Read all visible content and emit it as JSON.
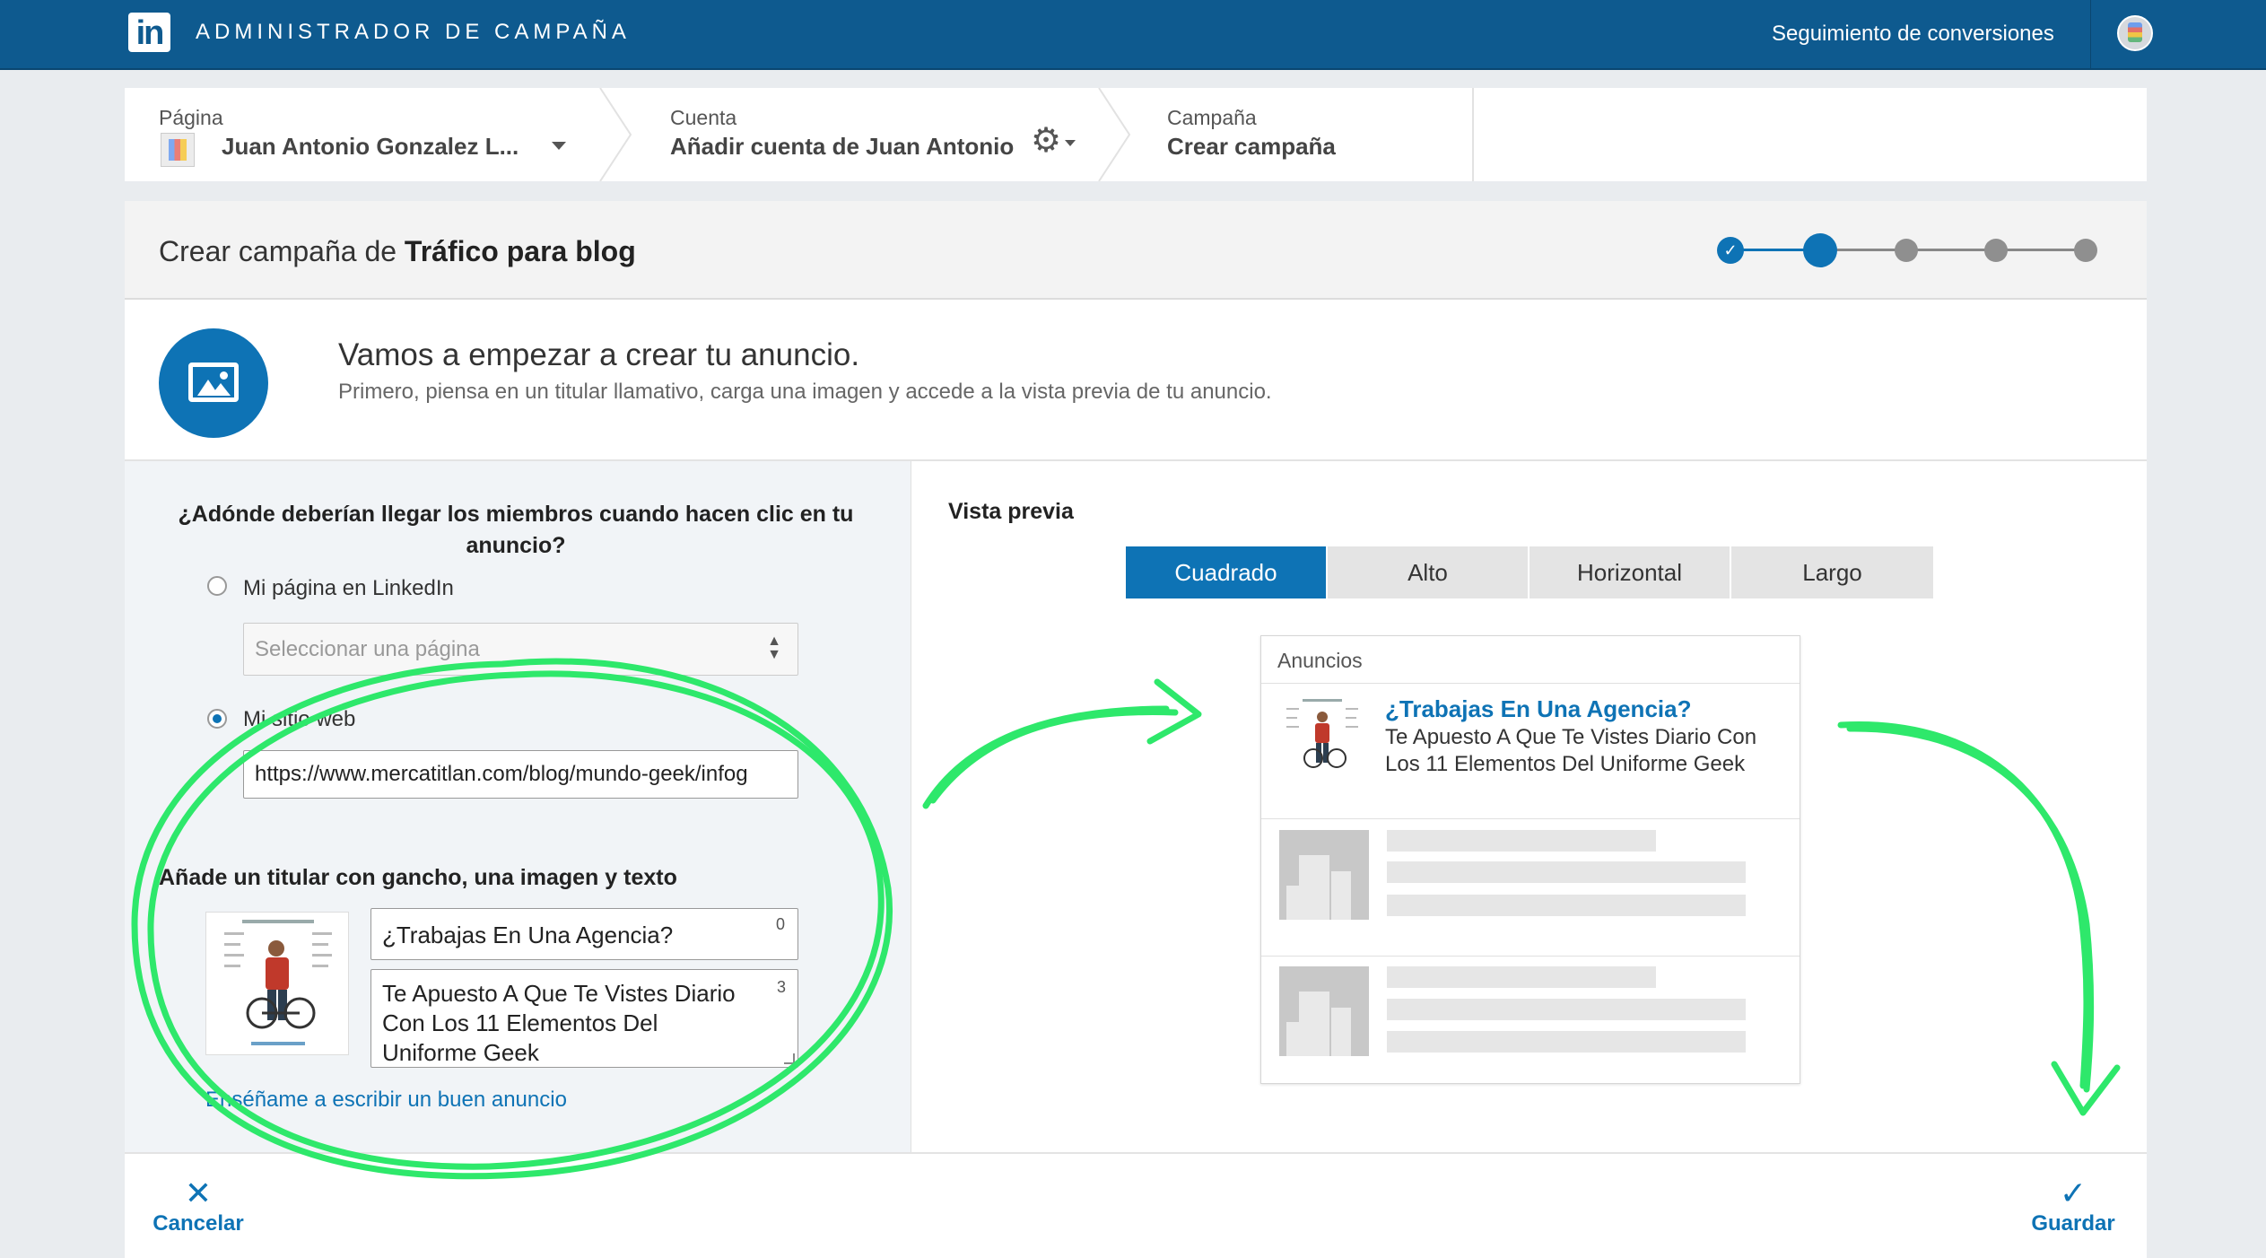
{
  "topbar": {
    "logo": "in",
    "app_title": "ADMINISTRADOR DE CAMPAÑA",
    "conversion_link": "Seguimiento de conversiones"
  },
  "breadcrumb": {
    "page": {
      "label": "Página",
      "value": "Juan Antonio Gonzalez L..."
    },
    "account": {
      "label": "Cuenta",
      "value": "Añadir cuenta de Juan Antonio"
    },
    "campaign": {
      "label": "Campaña",
      "value": "Crear campaña"
    }
  },
  "header": {
    "title_prefix": "Crear campaña de ",
    "title_bold": "Tráfico para blog",
    "steps_total": 5,
    "current_step": 2
  },
  "intro": {
    "heading": "Vamos a empezar a crear tu anuncio.",
    "subheading": "Primero, piensa en un titular llamativo, carga una imagen y accede a la vista previa de tu anuncio."
  },
  "form": {
    "question": "¿Adónde deberían llegar los miembros cuando hacen clic en tu anuncio?",
    "option_linkedin": "Mi página en LinkedIn",
    "select_placeholder": "Seleccionar una página",
    "option_website": "Mi sitio web",
    "website_url": "https://www.mercatitlan.com/blog/mundo-geek/infog",
    "section_title": "Añade un titular con gancho, una imagen y texto",
    "headline": "¿Trabajas En Una Agencia?",
    "headline_counter": "0",
    "body_text": "Te Apuesto A Que Te Vistes Diario Con Los 11 Elementos Del Uniforme Geek",
    "body_counter": "3",
    "help_link": "Enséñame a escribir un buen anuncio"
  },
  "preview": {
    "title": "Vista previa",
    "tabs": [
      {
        "label": "Cuadrado",
        "active": true
      },
      {
        "label": "Alto",
        "active": false
      },
      {
        "label": "Horizontal",
        "active": false
      },
      {
        "label": "Largo",
        "active": false
      }
    ],
    "ads_label": "Anuncios",
    "ad_headline": "¿Trabajas En Una Agencia?",
    "ad_text": "Te Apuesto A Que Te Vistes Diario Con Los 11 Elementos Del Uniforme Geek"
  },
  "actions": {
    "cancel": "Cancelar",
    "save": "Guardar"
  },
  "colors": {
    "brand": "#0e5a8f",
    "accent": "#0e73b5",
    "annotation": "#2ee86b"
  }
}
